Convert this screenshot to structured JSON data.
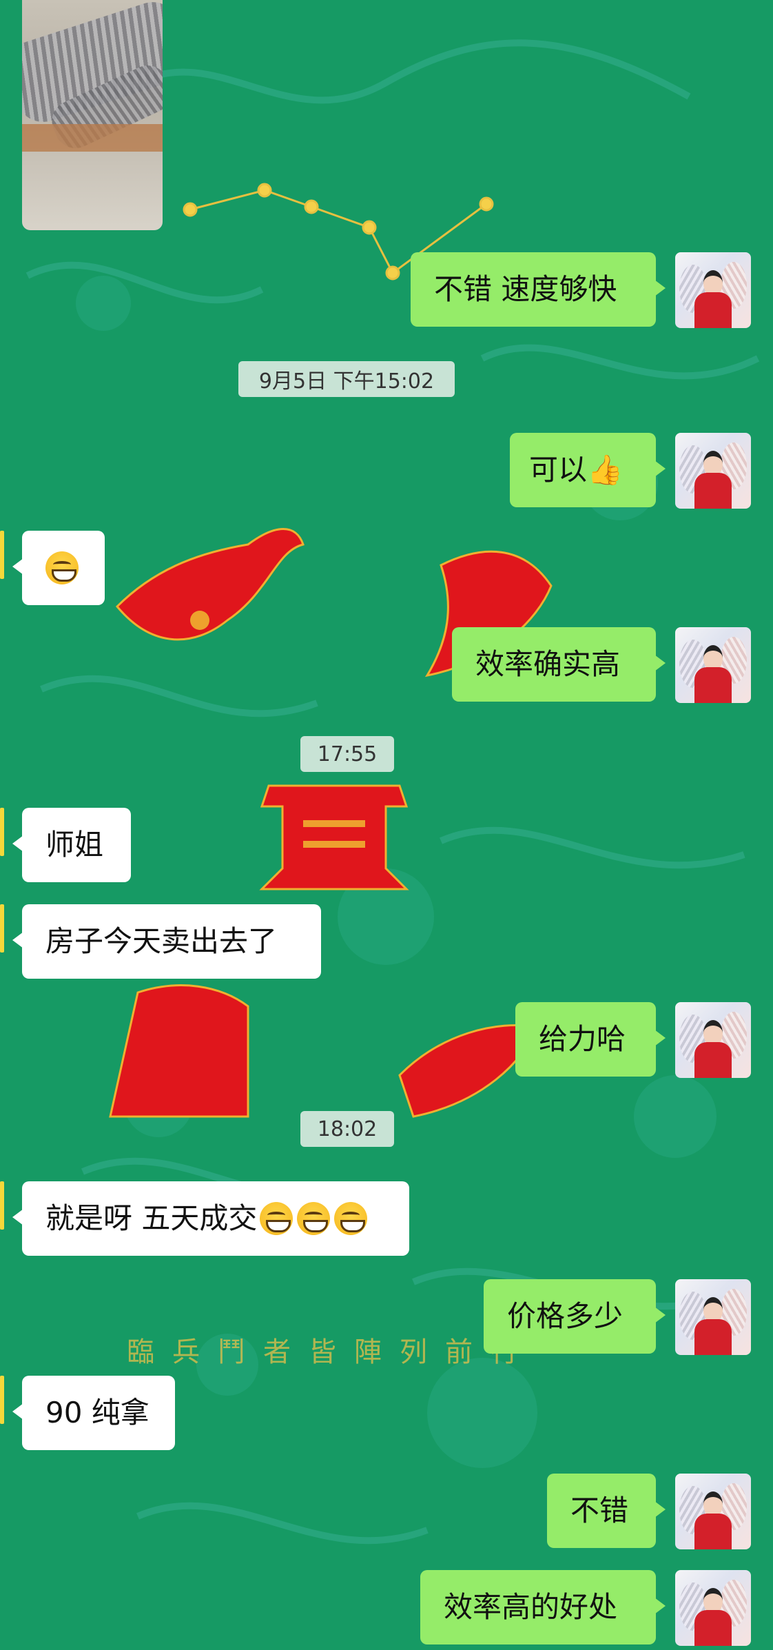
{
  "chat": {
    "timestamps": {
      "t1": "9月5日 下午15:02",
      "t2": "17:55",
      "t3": "18:02"
    },
    "messages": [
      {
        "id": "m1",
        "side": "out",
        "text": "不错 速度够快"
      },
      {
        "id": "m2",
        "side": "out",
        "text": "可以",
        "emoji": "thumbs-up"
      },
      {
        "id": "m3",
        "side": "in",
        "emoji": "grinning-face"
      },
      {
        "id": "m4",
        "side": "out",
        "text": "效率确实高"
      },
      {
        "id": "m5",
        "side": "in",
        "text": "师姐"
      },
      {
        "id": "m6",
        "side": "in",
        "text": "房子今天卖出去了"
      },
      {
        "id": "m7",
        "side": "out",
        "text": "给力哈"
      },
      {
        "id": "m8",
        "side": "in",
        "text": "就是呀 五天成交",
        "emoji": "grinning-face x3"
      },
      {
        "id": "m9",
        "side": "out",
        "text": "价格多少"
      },
      {
        "id": "m10",
        "side": "in",
        "text": "90 纯拿"
      },
      {
        "id": "m11",
        "side": "out",
        "text": "不错"
      },
      {
        "id": "m12",
        "side": "out",
        "text": "效率高的好处"
      }
    ]
  },
  "background": {
    "watermark_text": "臨兵鬥者皆陣列前行",
    "colors": {
      "base": "#169a64",
      "pattern": "#2aa88a",
      "seal_red": "#e0161c",
      "gold": "#f2c030"
    }
  },
  "colors": {
    "outgoing_bubble": "#95ec69",
    "incoming_bubble": "#ffffff",
    "timestamp_bg": "#dcebe1"
  }
}
